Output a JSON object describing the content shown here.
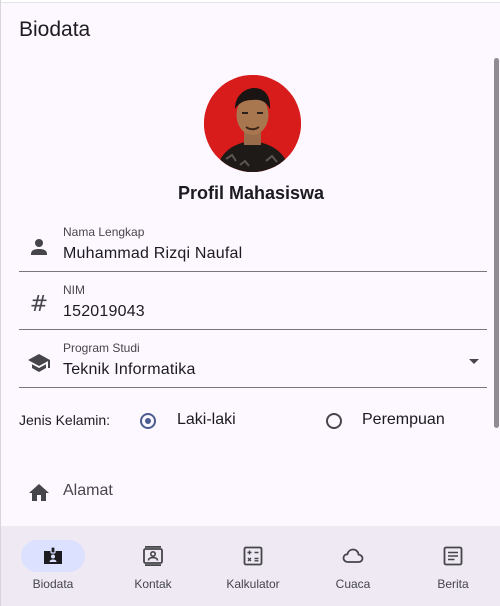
{
  "app": {
    "title": "Biodata"
  },
  "profile": {
    "heading": "Profil Mahasiswa"
  },
  "fields": {
    "name": {
      "label": "Nama Lengkap",
      "value": "Muhammad Rizqi Naufal",
      "icon": "person-icon"
    },
    "nim": {
      "label": "NIM",
      "value": "152019043",
      "icon": "hash-icon"
    },
    "program": {
      "label": "Program Studi",
      "value": "Teknik Informatika",
      "icon": "school-icon"
    }
  },
  "gender": {
    "label": "Jenis Kelamin:",
    "options": [
      {
        "label": "Laki-laki",
        "selected": true
      },
      {
        "label": "Perempuan",
        "selected": false
      }
    ]
  },
  "address": {
    "placeholder": "Alamat",
    "icon": "home-icon"
  },
  "nav": {
    "items": [
      {
        "label": "Biodata",
        "icon": "badge-icon",
        "active": true
      },
      {
        "label": "Kontak",
        "icon": "contact-icon",
        "active": false
      },
      {
        "label": "Kalkulator",
        "icon": "calculator-icon",
        "active": false
      },
      {
        "label": "Cuaca",
        "icon": "cloud-icon",
        "active": false
      },
      {
        "label": "Berita",
        "icon": "article-icon",
        "active": false
      }
    ]
  },
  "colors": {
    "background": "#fdf7ff",
    "accent": "#4a5c92",
    "nav_background": "#efe9f3",
    "nav_active_pill": "#dbe1ff",
    "avatar_background": "#d81c1c"
  }
}
